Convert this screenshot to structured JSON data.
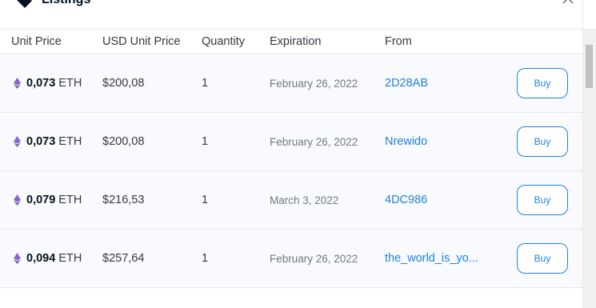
{
  "panel": {
    "title": "Listings"
  },
  "columns": {
    "unit_price": "Unit Price",
    "usd_unit_price": "USD Unit Price",
    "quantity": "Quantity",
    "expiration": "Expiration",
    "from": "From"
  },
  "rows": [
    {
      "price": "0,073",
      "currency": "ETH",
      "usd": "$200,08",
      "quantity": "1",
      "expiration": "February 26, 2022",
      "from": "2D28AB",
      "buy": "Buy"
    },
    {
      "price": "0,073",
      "currency": "ETH",
      "usd": "$200,08",
      "quantity": "1",
      "expiration": "February 26, 2022",
      "from": "Nrewido",
      "buy": "Buy"
    },
    {
      "price": "0,079",
      "currency": "ETH",
      "usd": "$216,53",
      "quantity": "1",
      "expiration": "March 3, 2022",
      "from": "4DC986",
      "buy": "Buy"
    },
    {
      "price": "0,094",
      "currency": "ETH",
      "usd": "$257,64",
      "quantity": "1",
      "expiration": "February 26, 2022",
      "from": "the_world_is_yo...",
      "buy": "Buy"
    }
  ],
  "icons": {
    "header": "tag-icon",
    "collapse": "chevron-up-icon",
    "currency": "eth-icon"
  },
  "colors": {
    "accent": "#2081e2",
    "row_background": "#f8fafd",
    "border": "#e5e8eb"
  }
}
